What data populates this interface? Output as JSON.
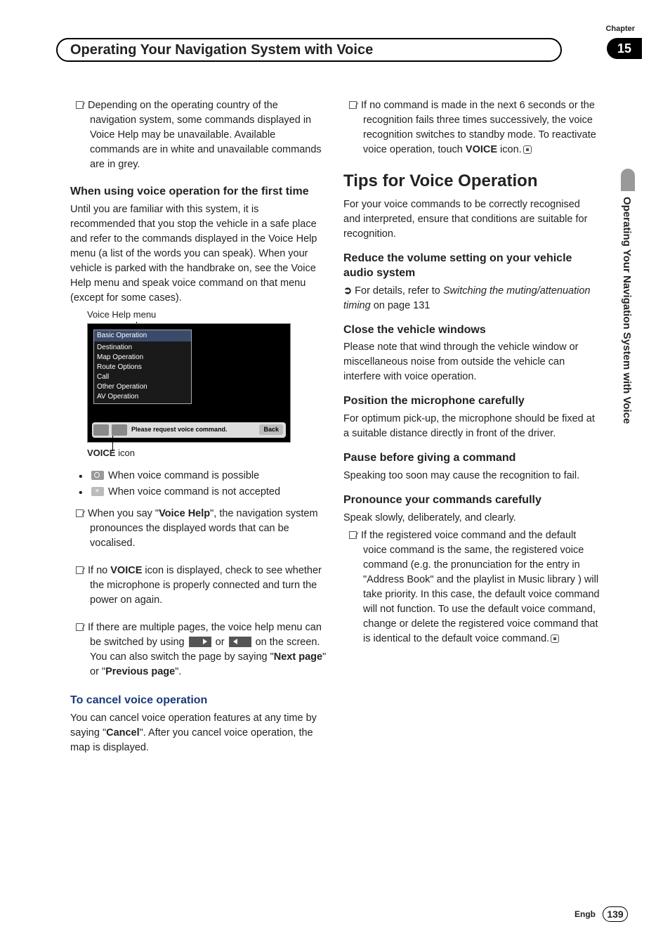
{
  "header": {
    "chapter_label": "Chapter",
    "chapter_number": "15",
    "title": "Operating Your Navigation System with Voice"
  },
  "side_tab": "Operating Your Navigation System with Voice",
  "left": {
    "note_availability": "Depending on the operating country of the navigation system, some commands displayed in Voice Help may be unavailable. Available commands are in white and unavailable commands are in grey.",
    "first_time_heading": "When using voice operation for the first time",
    "first_time_body": "Until you are familiar with this system, it is recommended that you stop the vehicle in a safe place and refer to the commands displayed in the Voice Help menu (a list of the words you can speak). When your vehicle is parked with the handbrake on, see the Voice Help menu and speak voice command on that menu (except for some cases).",
    "voice_help_caption": "Voice Help menu",
    "menu_items": [
      "Basic Operation",
      "Destination",
      "Map Operation",
      "Route Options",
      "Call",
      "Other Operation",
      "AV Operation"
    ],
    "screen_msg": "Please request voice command.",
    "back_label": "Back",
    "voice_icon_label": "VOICE",
    "voice_icon_suffix": " icon",
    "bullet_possible": " When voice command is possible",
    "bullet_not_accepted": " When voice command is not accepted",
    "voice_help_say_pre": "When you say \"",
    "voice_help_bold": "Voice Help",
    "voice_help_say_post": "\", the navigation system pronounces the displayed words that can be vocalised.",
    "no_voice_icon_pre": "If no ",
    "no_voice_icon_bold": "VOICE",
    "no_voice_icon_post": " icon is displayed, check to see whether the microphone is properly connected and turn the power on again.",
    "multiple_pages_pre": "If there are multiple pages, the voice help menu can be switched by using ",
    "multiple_pages_mid1": " or ",
    "multiple_pages_mid2": " on the screen. You can also switch the page by saying \"",
    "next_page": "Next page",
    "multiple_pages_mid3": "\" or \"",
    "prev_page": "Previous page",
    "multiple_pages_end": "\".",
    "cancel_heading": "To cancel voice operation",
    "cancel_body_pre": "You can cancel voice operation features at any time by saying \"",
    "cancel_bold": "Cancel",
    "cancel_body_post": "\". After you cancel voice operation, the map is displayed."
  },
  "right": {
    "no_command_pre": "If no command is made in the next 6 seconds or the recognition fails three times successively, the voice recognition switches to standby mode. To reactivate voice operation, touch ",
    "no_command_bold": "VOICE",
    "no_command_post": " icon.",
    "tips_heading": "Tips for Voice Operation",
    "tips_intro": "For your voice commands to be correctly recognised and interpreted, ensure that conditions are suitable for recognition.",
    "reduce_heading": "Reduce the volume setting on your vehicle audio system",
    "reduce_ref_pre": "For details, refer to ",
    "reduce_ref_italic": "Switching the muting/attenuation timing",
    "reduce_ref_post": " on page 131",
    "close_heading": "Close the vehicle windows",
    "close_body": "Please note that wind through the vehicle window or miscellaneous noise from outside the vehicle can interfere with voice operation.",
    "mic_heading": "Position the microphone carefully",
    "mic_body": "For optimum pick-up, the microphone should be fixed at a suitable distance directly in front of the driver.",
    "pause_heading": "Pause before giving a command",
    "pause_body": "Speaking too soon may cause the recognition to fail.",
    "pronounce_heading": "Pronounce your commands carefully",
    "pronounce_intro": "Speak slowly, deliberately, and clearly.",
    "pronounce_note": "If the registered voice command and the default voice command is the same, the registered voice command (e.g. the pronunciation for the entry in \"Address Book\" and the playlist in Music library ) will take priority. In this case, the default voice command will not function. To use the default voice command, change or delete the registered voice command that is identical to the default voice command."
  },
  "footer": {
    "lang": "Engb",
    "page": "139"
  }
}
